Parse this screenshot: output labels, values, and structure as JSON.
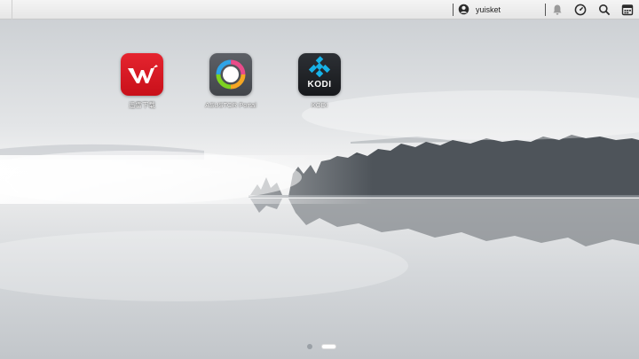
{
  "topbar": {
    "username": "yuisket",
    "icons": [
      "user-icon",
      "bell-icon",
      "speedometer-icon",
      "search-icon",
      "calendar-icon"
    ]
  },
  "apps": [
    {
      "label": "迅雷下载",
      "icon": "xunlei-icon",
      "color": "#d81b24"
    },
    {
      "label": "ASUSTOR Portal",
      "icon": "asustor-portal-icon",
      "color": "#4f5257"
    },
    {
      "label": "KODI",
      "icon": "kodi-icon",
      "tile_text": "KODI",
      "color": "#1f2226"
    }
  ],
  "pager": {
    "pages": 2,
    "current": 2
  },
  "colors": {
    "accent_kodi": "#17b2e7",
    "xunlei_red": "#d81b24"
  }
}
